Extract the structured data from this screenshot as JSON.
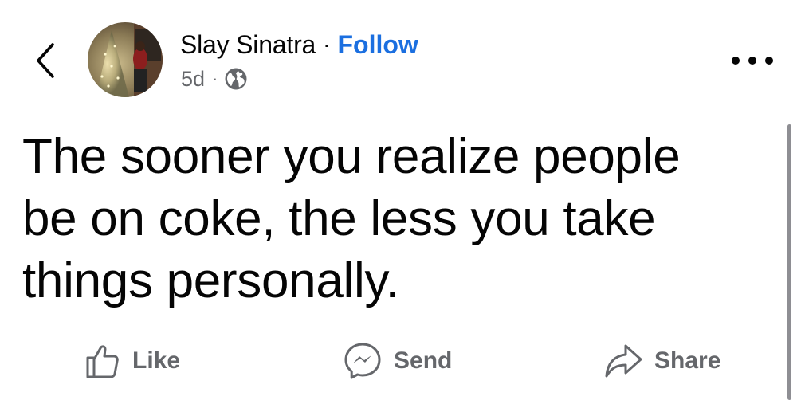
{
  "post": {
    "author": {
      "name": "Slay Sinatra",
      "separator": "·",
      "follow_label": "Follow"
    },
    "meta": {
      "age": "5d",
      "separator": "·",
      "audience_icon": "globe-icon"
    },
    "text": "The sooner you realize people be on coke, the less you take things personally."
  },
  "actions": {
    "like_label": "Like",
    "send_label": "Send",
    "share_label": "Share"
  },
  "icons": {
    "back": "chevron-left-icon",
    "more": "more-options-icon",
    "like": "thumbs-up-icon",
    "send": "messenger-icon",
    "share": "share-arrow-icon"
  },
  "colors": {
    "text": "#050505",
    "secondary_text": "#65676b",
    "link": "#1b6fe0",
    "background": "#ffffff"
  }
}
